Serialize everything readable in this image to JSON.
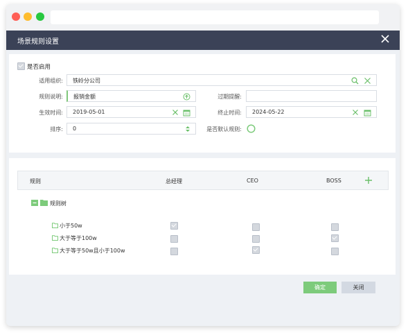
{
  "dialog": {
    "title": "场景规则设置"
  },
  "form": {
    "enable_label": "是否启用",
    "enable_checked": true,
    "org_label": "适用组织:",
    "org_value": "铁岭分公司",
    "desc_label": "规则说明:",
    "desc_value": "报销金额",
    "expire_label": "过期提醒:",
    "expire_value": "",
    "start_label": "生效时间:",
    "start_value": "2019-05-01",
    "end_label": "终止时间:",
    "end_value": "2024-05-22",
    "order_label": "排序:",
    "order_value": "0",
    "default_label": "是否默认规则:"
  },
  "table": {
    "columns": [
      "规则",
      "总经理",
      "CEO",
      "BOSS"
    ],
    "root_label": "规则树",
    "rows": [
      {
        "label": "小于50w",
        "checks": [
          true,
          false,
          false
        ]
      },
      {
        "label": "大于等于100w",
        "checks": [
          false,
          false,
          true
        ]
      },
      {
        "label": "大于等于50w且小于100w",
        "checks": [
          false,
          true,
          false
        ]
      }
    ]
  },
  "buttons": {
    "confirm": "确定",
    "close": "关闭"
  },
  "colors": {
    "accent": "#7dcb7b",
    "header": "#3b4257"
  }
}
